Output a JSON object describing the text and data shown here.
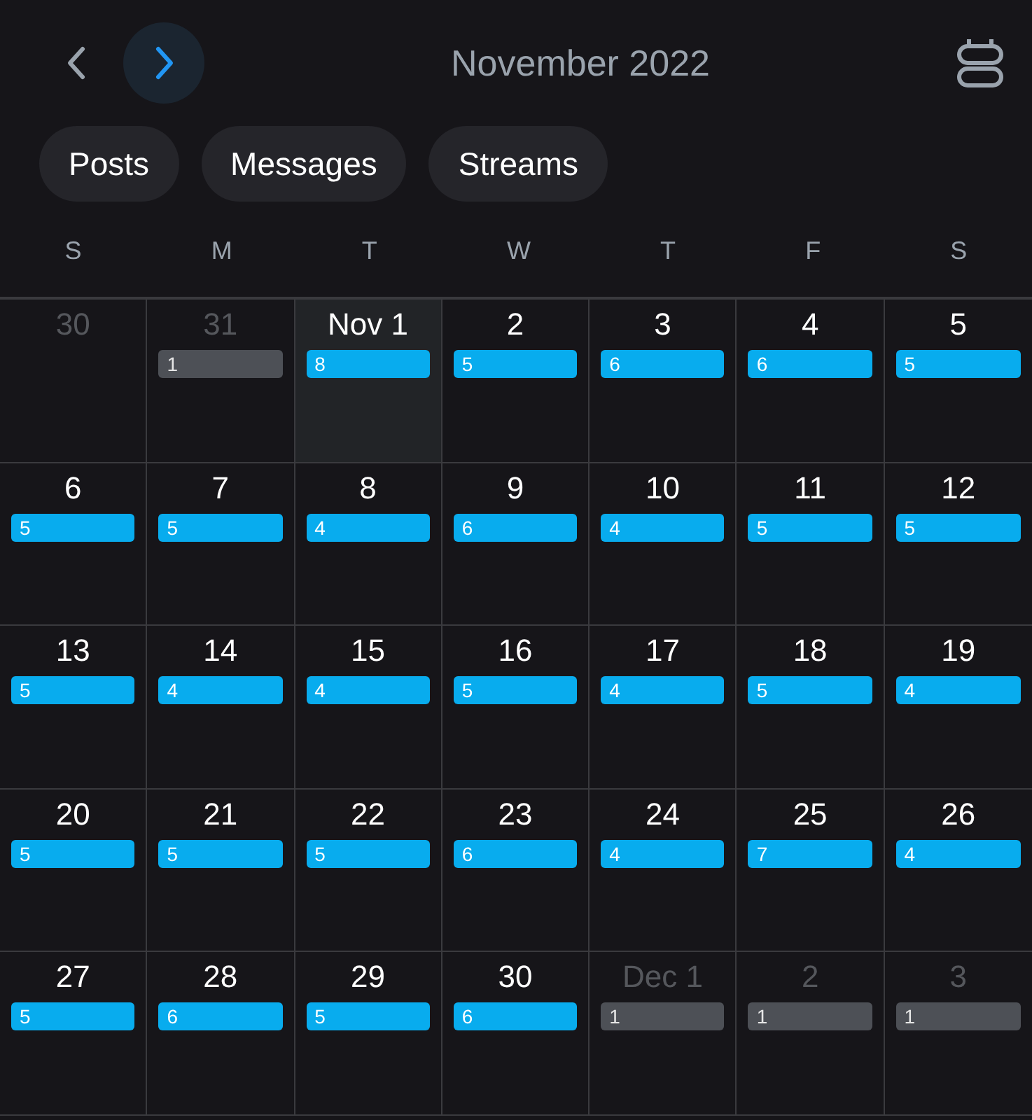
{
  "header": {
    "title": "November 2022",
    "nav": [
      {
        "kind": "prev",
        "highlighted": false
      },
      {
        "kind": "next",
        "highlighted": true
      }
    ]
  },
  "filters": [
    {
      "label": "Posts"
    },
    {
      "label": "Messages"
    },
    {
      "label": "Streams"
    }
  ],
  "weekdays": [
    "S",
    "M",
    "T",
    "W",
    "T",
    "F",
    "S"
  ],
  "weeks": [
    [
      {
        "label": "30",
        "in_month": false,
        "selected": false
      },
      {
        "label": "31",
        "in_month": false,
        "selected": false,
        "count": "1"
      },
      {
        "label": "Nov 1",
        "in_month": true,
        "selected": true,
        "count": "8"
      },
      {
        "label": "2",
        "in_month": true,
        "selected": false,
        "count": "5"
      },
      {
        "label": "3",
        "in_month": true,
        "selected": false,
        "count": "6"
      },
      {
        "label": "4",
        "in_month": true,
        "selected": false,
        "count": "6"
      },
      {
        "label": "5",
        "in_month": true,
        "selected": false,
        "count": "5"
      }
    ],
    [
      {
        "label": "6",
        "in_month": true,
        "selected": false,
        "count": "5"
      },
      {
        "label": "7",
        "in_month": true,
        "selected": false,
        "count": "5"
      },
      {
        "label": "8",
        "in_month": true,
        "selected": false,
        "count": "4"
      },
      {
        "label": "9",
        "in_month": true,
        "selected": false,
        "count": "6"
      },
      {
        "label": "10",
        "in_month": true,
        "selected": false,
        "count": "4"
      },
      {
        "label": "11",
        "in_month": true,
        "selected": false,
        "count": "5"
      },
      {
        "label": "12",
        "in_month": true,
        "selected": false,
        "count": "5"
      }
    ],
    [
      {
        "label": "13",
        "in_month": true,
        "selected": false,
        "count": "5"
      },
      {
        "label": "14",
        "in_month": true,
        "selected": false,
        "count": "4"
      },
      {
        "label": "15",
        "in_month": true,
        "selected": false,
        "count": "4"
      },
      {
        "label": "16",
        "in_month": true,
        "selected": false,
        "count": "5"
      },
      {
        "label": "17",
        "in_month": true,
        "selected": false,
        "count": "4"
      },
      {
        "label": "18",
        "in_month": true,
        "selected": false,
        "count": "5"
      },
      {
        "label": "19",
        "in_month": true,
        "selected": false,
        "count": "4"
      }
    ],
    [
      {
        "label": "20",
        "in_month": true,
        "selected": false,
        "count": "5"
      },
      {
        "label": "21",
        "in_month": true,
        "selected": false,
        "count": "5"
      },
      {
        "label": "22",
        "in_month": true,
        "selected": false,
        "count": "5"
      },
      {
        "label": "23",
        "in_month": true,
        "selected": false,
        "count": "6"
      },
      {
        "label": "24",
        "in_month": true,
        "selected": false,
        "count": "4"
      },
      {
        "label": "25",
        "in_month": true,
        "selected": false,
        "count": "7"
      },
      {
        "label": "26",
        "in_month": true,
        "selected": false,
        "count": "4"
      }
    ],
    [
      {
        "label": "27",
        "in_month": true,
        "selected": false,
        "count": "5"
      },
      {
        "label": "28",
        "in_month": true,
        "selected": false,
        "count": "6"
      },
      {
        "label": "29",
        "in_month": true,
        "selected": false,
        "count": "5"
      },
      {
        "label": "30",
        "in_month": true,
        "selected": false,
        "count": "6"
      },
      {
        "label": "Dec 1",
        "in_month": false,
        "selected": false,
        "count": "1"
      },
      {
        "label": "2",
        "in_month": false,
        "selected": false,
        "count": "1"
      },
      {
        "label": "3",
        "in_month": false,
        "selected": false,
        "count": "1"
      }
    ]
  ]
}
